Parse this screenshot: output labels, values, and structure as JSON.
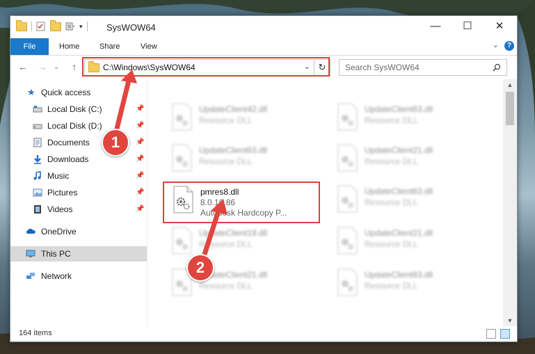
{
  "window": {
    "title": "SysWOW64"
  },
  "ribbon": {
    "tabs": [
      "File",
      "Home",
      "Share",
      "View"
    ],
    "help_label": "?"
  },
  "address": {
    "path": "C:\\Windows\\SysWOW64",
    "search_placeholder": "Search SysWOW64"
  },
  "nav": {
    "quick_access": "Quick access",
    "items": [
      "Local Disk (C:)",
      "Local Disk (D:)",
      "Documents",
      "Downloads",
      "Music",
      "Pictures",
      "Videos"
    ],
    "onedrive": "OneDrive",
    "thispc": "This PC",
    "network": "Network"
  },
  "files": {
    "blurred_left": [
      {
        "name": "UpdateClient42.dll",
        "type": "Resource DLL"
      },
      {
        "name": "UpdateClient63.dll",
        "type": "Resource DLL"
      },
      {
        "name": "UpdateClient19.dll",
        "type": "Resource DLL"
      },
      {
        "name": "UpdateClient21.dll",
        "type": "Resource DLL"
      }
    ],
    "blurred_right": [
      {
        "name": "UpdateClient63.dll",
        "type": "Resource DLL"
      },
      {
        "name": "UpdateClient21.dll",
        "type": "Resource DLL"
      },
      {
        "name": "UpdateClient63.dll",
        "type": "Resource DLL"
      },
      {
        "name": "UpdateClient21.dll",
        "type": "Resource DLL"
      },
      {
        "name": "UpdateClient63.dll",
        "type": "Resource DLL"
      }
    ],
    "highlighted": {
      "name": "pmres8.dll",
      "version": "8.0.16.86",
      "description": "Autodesk Hardcopy P..."
    }
  },
  "status": {
    "count": "164 items"
  },
  "callouts": [
    "1",
    "2"
  ],
  "colors": {
    "accent": "#1979ca",
    "highlight_box": "#d9413a",
    "callout_fill": "#e0463f"
  }
}
